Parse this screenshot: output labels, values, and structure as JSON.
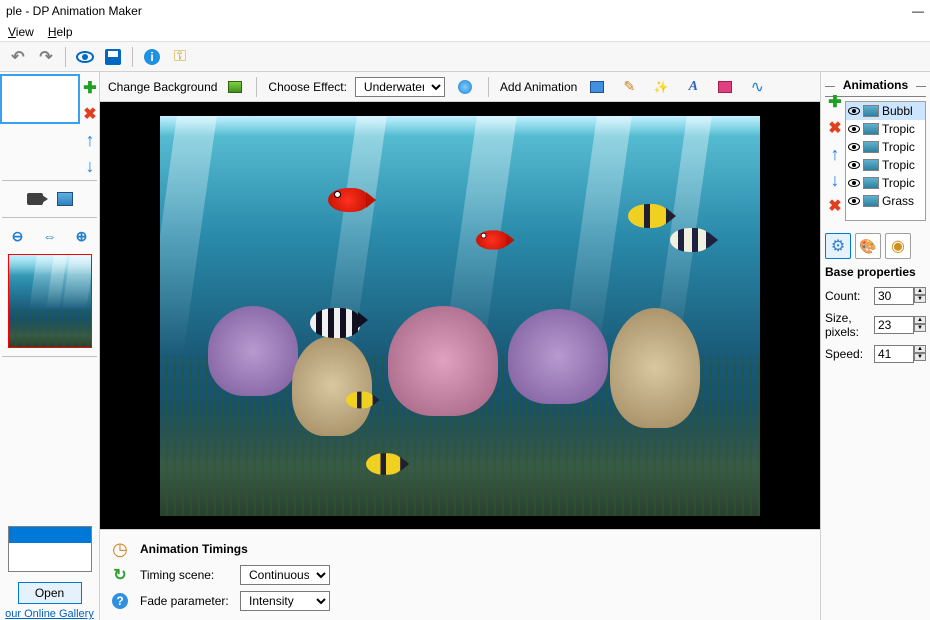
{
  "window": {
    "title": "ple - DP Animation Maker"
  },
  "menu": {
    "view": "View",
    "help": "Help"
  },
  "canvasbar": {
    "change_bg": "Change Background",
    "choose_effect": "Choose Effect:",
    "effect_value": "Underwater",
    "add_animation": "Add Animation"
  },
  "left": {
    "open": "Open",
    "gallery": "our Online Gallery"
  },
  "timings": {
    "title": "Animation Timings",
    "scene_label": "Timing scene:",
    "scene_value": "Continuous",
    "fade_label": "Fade parameter:",
    "fade_value": "Intensity"
  },
  "right": {
    "panel_title": "Animations",
    "items": [
      {
        "name": "Bubbl"
      },
      {
        "name": "Tropic"
      },
      {
        "name": "Tropic"
      },
      {
        "name": "Tropic"
      },
      {
        "name": "Tropic"
      },
      {
        "name": "Grass"
      }
    ],
    "props_title": "Base properties",
    "count_label": "Count:",
    "count_value": "30",
    "size_label": "Size, pixels:",
    "size_value": "23",
    "speed_label": "Speed:",
    "speed_value": "41"
  }
}
